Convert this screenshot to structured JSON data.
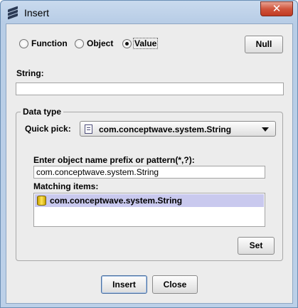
{
  "window": {
    "title": "Insert",
    "close_glyph": "✕",
    "icon": "stack-icon"
  },
  "mode": {
    "options": [
      "Function",
      "Object",
      "Value"
    ],
    "selected": "Value",
    "null_label": "Null"
  },
  "string_field": {
    "label": "String:",
    "value": ""
  },
  "data_type": {
    "title": "Data type",
    "quick_pick_label": "Quick pick:",
    "quick_pick_value": "com.conceptwave.system.String",
    "quick_pick_icon": "document-icon",
    "pattern_label": "Enter object name prefix or pattern(*,?):",
    "pattern_value": "com.conceptwave.system.String",
    "matching_label": "Matching items:",
    "matching_items": [
      {
        "label": "com.conceptwave.system.String",
        "icon": "cylinder-icon",
        "selected": true
      }
    ],
    "set_label": "Set"
  },
  "footer": {
    "insert_label": "Insert",
    "close_label": "Close"
  }
}
